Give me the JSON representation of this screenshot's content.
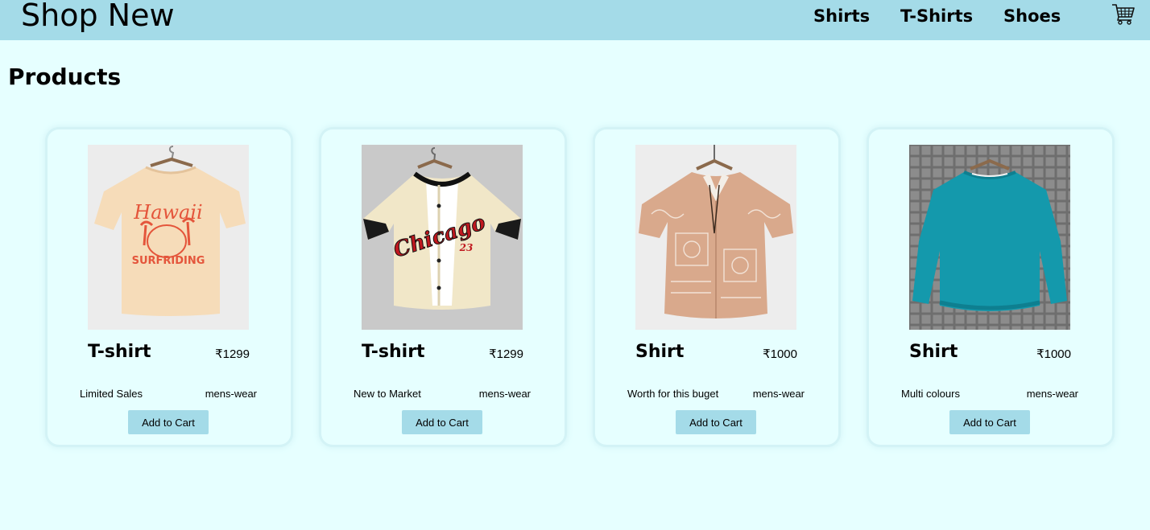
{
  "header": {
    "brand": "Shop New",
    "nav": [
      "Shirts",
      "T-Shirts",
      "Shoes"
    ],
    "cart_icon": "cart-icon",
    "background": "#a4dbe8"
  },
  "page": {
    "title": "Products",
    "background": "#e6ffff"
  },
  "products": [
    {
      "name": "T-shirt",
      "price": "₹1299",
      "tag": "Limited Sales",
      "category": "mens-wear",
      "button": "Add to Cart",
      "image": "cream Hawaii surfriding t-shirt"
    },
    {
      "name": "T-shirt",
      "price": "₹1299",
      "tag": "New to Market",
      "category": "mens-wear",
      "button": "Add to Cart",
      "image": "cream Chicago baseball shirt"
    },
    {
      "name": "Shirt",
      "price": "₹1000",
      "tag": "Worth for this buget",
      "category": "mens-wear",
      "button": "Add to Cart",
      "image": "paisley patchwork shirt"
    },
    {
      "name": "Shirt",
      "price": "₹1000",
      "tag": "Multi colours",
      "category": "mens-wear",
      "button": "Add to Cart",
      "image": "teal sweatshirt"
    }
  ]
}
